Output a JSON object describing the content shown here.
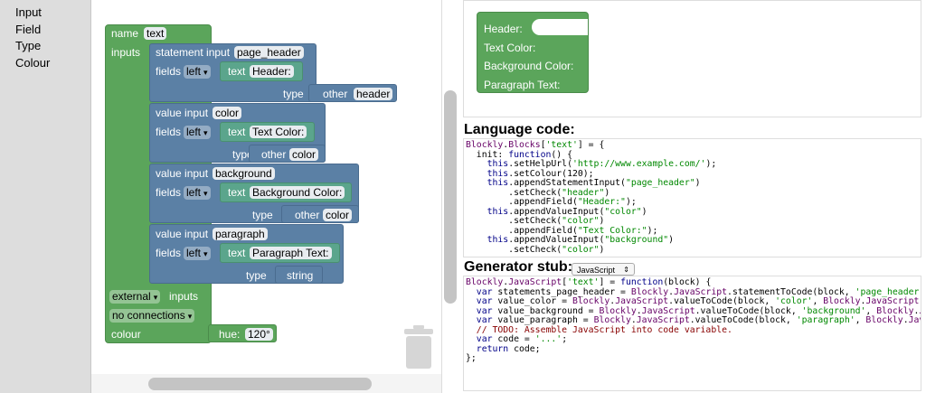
{
  "toolbox": {
    "categories": [
      "Input",
      "Field",
      "Type",
      "Colour"
    ]
  },
  "block": {
    "name_label": "name",
    "name_value": "text",
    "inputs_label": "inputs",
    "stmt_label": "statement input",
    "stmt_name": "page_header",
    "fields_label": "fields",
    "align_left": "left",
    "text_label": "text",
    "header_text": "Header:",
    "type_label": "type",
    "other_label": "other",
    "header_type": "header",
    "value_input_label": "value input",
    "color_name": "color",
    "color_text": "Text Color:",
    "color_type": "color",
    "background_name": "background",
    "background_text": "Background Color:",
    "background_type": "color",
    "paragraph_name": "paragraph",
    "paragraph_text": "Paragraph Text:",
    "string_label": "string",
    "external_label": "external",
    "inputs_suffix": "inputs",
    "connections_label": "no connections",
    "colour_label": "colour",
    "hue_label": "hue:",
    "hue_value": "120°"
  },
  "preview": {
    "header": "Header:",
    "text_color": "Text Color:",
    "background_color": "Background Color:",
    "paragraph_text": "Paragraph Text:"
  },
  "language_code": {
    "title": "Language code:"
  },
  "generator": {
    "title": "Generator stub:",
    "selected": "JavaScript"
  },
  "colors": {
    "block_green": "#5ba55b",
    "block_blue": "#5b80a5",
    "block_teal": "#5ba58c"
  }
}
